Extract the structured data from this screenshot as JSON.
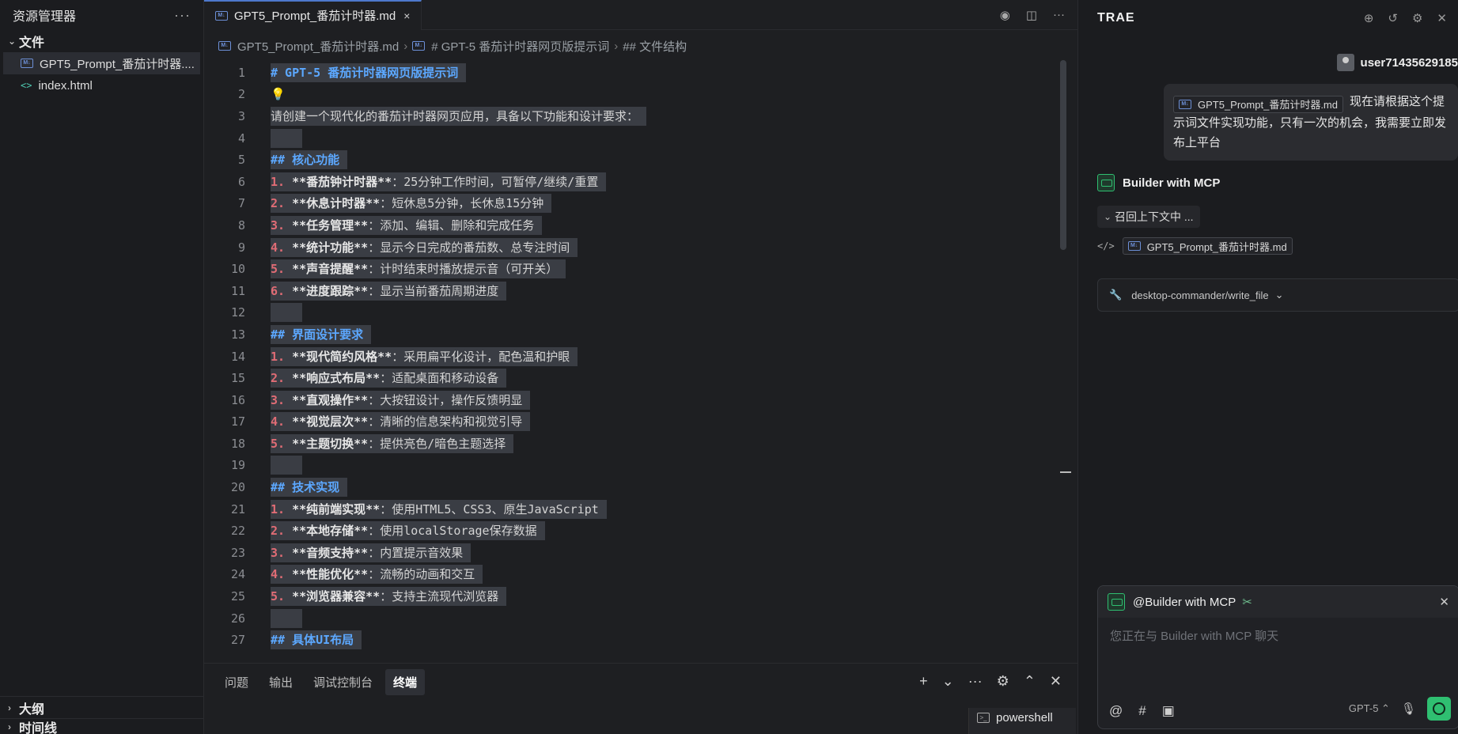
{
  "sidebar": {
    "title": "资源管理器",
    "more": "···",
    "files_section": "文件",
    "files": [
      {
        "name": "GPT5_Prompt_番茄计时器....",
        "type": "md"
      },
      {
        "name": "index.html",
        "type": "html"
      }
    ],
    "outline_section": "大纲",
    "timeline_section": "时间线"
  },
  "editor": {
    "tab_title": "GPT5_Prompt_番茄计时器.md",
    "tab_close": "×",
    "breadcrumb": [
      "GPT5_Prompt_番茄计时器.md",
      "# GPT-5 番茄计时器网页版提示词",
      "## 文件结构"
    ],
    "lines": [
      {
        "no": "1",
        "parts": [
          [
            "h",
            "# GPT-5 番茄计时器网页版提示词"
          ]
        ]
      },
      {
        "no": "2",
        "parts": [
          [
            "bulb",
            "💡"
          ]
        ]
      },
      {
        "no": "3",
        "parts": [
          [
            "t",
            "请创建一个现代化的番茄计时器网页应用，具备以下功能和设计要求："
          ]
        ]
      },
      {
        "no": "4",
        "parts": []
      },
      {
        "no": "5",
        "parts": [
          [
            "h",
            "## 核心功能"
          ]
        ]
      },
      {
        "no": "6",
        "parts": [
          [
            "n",
            "1. "
          ],
          [
            "b",
            "**番茄钟计时器**"
          ],
          [
            "t",
            "：25分钟工作时间，可暂停/继续/重置"
          ]
        ]
      },
      {
        "no": "7",
        "parts": [
          [
            "n",
            "2. "
          ],
          [
            "b",
            "**休息计时器**"
          ],
          [
            "t",
            "：短休息5分钟，长休息15分钟"
          ]
        ]
      },
      {
        "no": "8",
        "parts": [
          [
            "n",
            "3. "
          ],
          [
            "b",
            "**任务管理**"
          ],
          [
            "t",
            "：添加、编辑、删除和完成任务"
          ]
        ]
      },
      {
        "no": "9",
        "parts": [
          [
            "n",
            "4. "
          ],
          [
            "b",
            "**统计功能**"
          ],
          [
            "t",
            "：显示今日完成的番茄数、总专注时间"
          ]
        ]
      },
      {
        "no": "10",
        "parts": [
          [
            "n",
            "5. "
          ],
          [
            "b",
            "**声音提醒**"
          ],
          [
            "t",
            "：计时结束时播放提示音（可开关）"
          ]
        ]
      },
      {
        "no": "11",
        "parts": [
          [
            "n",
            "6. "
          ],
          [
            "b",
            "**进度跟踪**"
          ],
          [
            "t",
            "：显示当前番茄周期进度"
          ]
        ]
      },
      {
        "no": "12",
        "parts": []
      },
      {
        "no": "13",
        "parts": [
          [
            "h",
            "## 界面设计要求"
          ]
        ]
      },
      {
        "no": "14",
        "parts": [
          [
            "n",
            "1. "
          ],
          [
            "b",
            "**现代简约风格**"
          ],
          [
            "t",
            "：采用扁平化设计，配色温和护眼"
          ]
        ]
      },
      {
        "no": "15",
        "parts": [
          [
            "n",
            "2. "
          ],
          [
            "b",
            "**响应式布局**"
          ],
          [
            "t",
            "：适配桌面和移动设备"
          ]
        ]
      },
      {
        "no": "16",
        "parts": [
          [
            "n",
            "3. "
          ],
          [
            "b",
            "**直观操作**"
          ],
          [
            "t",
            "：大按钮设计，操作反馈明显"
          ]
        ]
      },
      {
        "no": "17",
        "parts": [
          [
            "n",
            "4. "
          ],
          [
            "b",
            "**视觉层次**"
          ],
          [
            "t",
            "：清晰的信息架构和视觉引导"
          ]
        ]
      },
      {
        "no": "18",
        "parts": [
          [
            "n",
            "5. "
          ],
          [
            "b",
            "**主题切换**"
          ],
          [
            "t",
            "：提供亮色/暗色主题选择"
          ]
        ]
      },
      {
        "no": "19",
        "parts": []
      },
      {
        "no": "20",
        "parts": [
          [
            "h",
            "## 技术实现"
          ]
        ]
      },
      {
        "no": "21",
        "parts": [
          [
            "n",
            "1. "
          ],
          [
            "b",
            "**纯前端实现**"
          ],
          [
            "t",
            "：使用HTML5、CSS3、原生JavaScript"
          ]
        ]
      },
      {
        "no": "22",
        "parts": [
          [
            "n",
            "2. "
          ],
          [
            "b",
            "**本地存储**"
          ],
          [
            "t",
            "：使用localStorage保存数据"
          ]
        ]
      },
      {
        "no": "23",
        "parts": [
          [
            "n",
            "3. "
          ],
          [
            "b",
            "**音频支持**"
          ],
          [
            "t",
            "：内置提示音效果"
          ]
        ]
      },
      {
        "no": "24",
        "parts": [
          [
            "n",
            "4. "
          ],
          [
            "b",
            "**性能优化**"
          ],
          [
            "t",
            "：流畅的动画和交互"
          ]
        ]
      },
      {
        "no": "25",
        "parts": [
          [
            "n",
            "5. "
          ],
          [
            "b",
            "**浏览器兼容**"
          ],
          [
            "t",
            "：支持主流现代浏览器"
          ]
        ]
      },
      {
        "no": "26",
        "parts": []
      },
      {
        "no": "27",
        "parts": [
          [
            "h",
            "## 具体UI布局"
          ]
        ]
      }
    ]
  },
  "panel": {
    "tabs": [
      "问题",
      "输出",
      "调试控制台",
      "终端"
    ],
    "active_tab": "终端",
    "terminals": [
      "powershell"
    ]
  },
  "chat": {
    "brand": "TRAE",
    "user_name": "user71435629185",
    "message_chip": "GPT5_Prompt_番茄计时器.md",
    "message_text": "现在请根据这个提示词文件实现功能，只有一次的机会，我需要立即发布上平台",
    "agent_name": "Builder with MCP",
    "recall_label": "召回上下文中 ...",
    "file_ref": "GPT5_Prompt_番茄计时器.md",
    "tool_call": "desktop-commander/write_file",
    "input_agent": "@Builder with MCP",
    "input_placeholder": "您正在与 Builder with MCP 聊天",
    "model": "GPT-5"
  }
}
